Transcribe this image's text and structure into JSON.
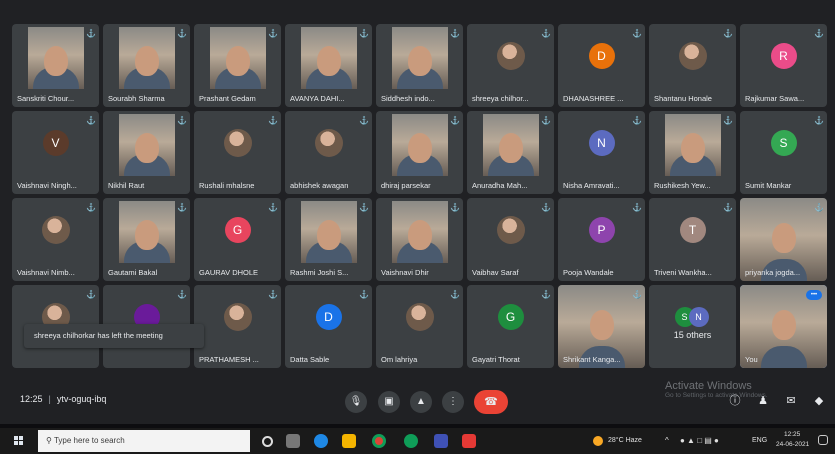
{
  "grid": {
    "rows": [
      [
        {
          "name": "Sanskriti Chour...",
          "type": "video"
        },
        {
          "name": "Sourabh Sharma",
          "type": "video"
        },
        {
          "name": "Prashant Gedam",
          "type": "video"
        },
        {
          "name": "AVANYA DAHI...",
          "type": "video"
        },
        {
          "name": "Siddhesh indo...",
          "type": "video"
        },
        {
          "name": "shreeya chilhor...",
          "type": "photo"
        },
        {
          "name": "DHANASHREE ...",
          "type": "avatar",
          "initial": "D",
          "color": "#e8710a"
        },
        {
          "name": "Shantanu Honale",
          "type": "photo"
        },
        {
          "name": "Rajkumar Sawa...",
          "type": "avatar",
          "initial": "R",
          "color": "#ea4c89"
        }
      ],
      [
        {
          "name": "Vaishnavi Ningh...",
          "type": "avatar",
          "initial": "V",
          "color": "#5b3b2b"
        },
        {
          "name": "Nikhil Raut",
          "type": "video"
        },
        {
          "name": "Rushali mhalsne",
          "type": "photo"
        },
        {
          "name": "abhishek awagan",
          "type": "photo"
        },
        {
          "name": "dhiraj parsekar",
          "type": "video"
        },
        {
          "name": "Anuradha Mah...",
          "type": "video"
        },
        {
          "name": "Nisha Amravati...",
          "type": "avatar",
          "initial": "N",
          "color": "#5c6bc0"
        },
        {
          "name": "Rushikesh Yew...",
          "type": "video"
        },
        {
          "name": "Sumit Mankar",
          "type": "avatar",
          "initial": "S",
          "color": "#34a853"
        }
      ],
      [
        {
          "name": "Vaishnavi Nimb...",
          "type": "photo"
        },
        {
          "name": "Gautami Bakal",
          "type": "video"
        },
        {
          "name": "GAURAV DHOLE",
          "type": "avatar",
          "initial": "G",
          "color": "#e8455e"
        },
        {
          "name": "Rashmi Joshi S...",
          "type": "video"
        },
        {
          "name": "Vaishnavi Dhir",
          "type": "video"
        },
        {
          "name": "Vaibhav Saraf",
          "type": "photo"
        },
        {
          "name": "Pooja Wandale",
          "type": "avatar",
          "initial": "P",
          "color": "#8e44ad"
        },
        {
          "name": "Triveni Wankha...",
          "type": "avatar",
          "initial": "T",
          "color": "#a1887f"
        },
        {
          "name": "priyanka jogda...",
          "type": "video-full"
        }
      ],
      [
        {
          "name": "",
          "type": "photo"
        },
        {
          "name": "",
          "type": "avatar",
          "initial": "",
          "color": "#6a1b9a"
        },
        {
          "name": "PRATHAMESH ...",
          "type": "photo"
        },
        {
          "name": "Datta Sable",
          "type": "avatar",
          "initial": "D",
          "color": "#1a73e8"
        },
        {
          "name": "Om lahriya",
          "type": "photo"
        },
        {
          "name": "Gayatri Thorat",
          "type": "avatar",
          "initial": "G",
          "color": "#1e8e3e"
        },
        {
          "name": "Shrikant Kanga...",
          "type": "video-full"
        },
        {
          "name": "15 others",
          "type": "others"
        },
        {
          "name": "You",
          "type": "self"
        }
      ]
    ]
  },
  "others": {
    "initials": [
      "S",
      "N"
    ],
    "colors": [
      "#1e8e3e",
      "#5c6bc0"
    ],
    "label": "15 others"
  },
  "toast": "shreeya chilhorkar has left the meeting",
  "bottom_bar": {
    "time": "12:25",
    "meeting_code": "ytv-oguq-ibq"
  },
  "watermark": {
    "title": "Activate Windows",
    "subtitle": "Go to Settings to activate Windows."
  },
  "taskbar": {
    "search_placeholder": "Type here to search",
    "weather": "28°C Haze",
    "lang": "ENG",
    "clock_time": "12:25",
    "clock_date": "24-06-2021"
  },
  "colors": {
    "accent": "#8ab4f8",
    "end_call": "#ea4335",
    "tile": "#3c4043",
    "background": "#202124"
  }
}
